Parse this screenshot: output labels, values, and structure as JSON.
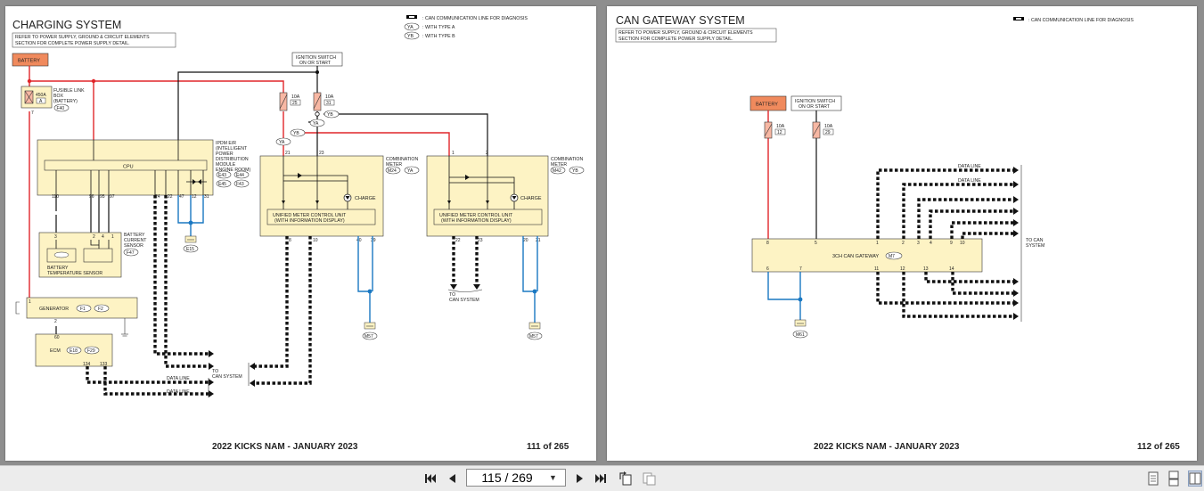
{
  "left_page": {
    "title": "CHARGING SYSTEM",
    "note_line1": "REFER TO POWER SUPPLY, GROUND & CIRCUIT ELEMENTS",
    "note_line2": "SECTION FOR COMPLETE POWER SUPPLY DETAIL.",
    "legend": {
      "can_line": ": CAN COMMUNICATION LINE FOR DIAGNOSIS",
      "type_a_tag": "YA",
      "type_a": ": WITH TYPE A",
      "type_b_tag": "YB",
      "type_b": ": WITH TYPE B"
    },
    "battery": "BATTERY",
    "ignition_line1": "IGNITION SWITCH",
    "ignition_line2": "ON OR START",
    "fuse_link": {
      "rating": "450A",
      "id": "A",
      "pin": "7",
      "label1": "FUSIBLE LINK",
      "label2": "BOX",
      "label3": "(BATTERY)",
      "connector": "F40"
    },
    "fuse_25": {
      "rating": "10A",
      "id": "25"
    },
    "fuse_31": {
      "rating": "10A",
      "id": "31"
    },
    "ipdm": {
      "label1": "IPDM E/R",
      "label2": "(INTELLIGENT",
      "label3": "POWER",
      "label4": "DISTRIBUTION",
      "label5": "MODULE",
      "label6": "ENGINE ROOM)",
      "conn1": "E43",
      "conn2": "E44",
      "conn3": "E45",
      "conn4": "F43",
      "cpu": "CPU",
      "pins": [
        "110",
        "96",
        "95",
        "97",
        "24",
        "22",
        "47",
        "12",
        "31"
      ]
    },
    "sensor": {
      "label1": "BATTERY",
      "label2": "CURRENT",
      "label3": "SENSOR",
      "connector": "F47",
      "temp1": "BATTERY",
      "temp2": "TEMPERATURE SENSOR",
      "pins": [
        "3",
        "2",
        "4",
        "1"
      ]
    },
    "ground_e15": "E15",
    "generator": {
      "label": "GENERATOR",
      "conn1": "F1",
      "conn2": "F2",
      "pin_top": "1",
      "pin_bottom": "2"
    },
    "ecm": {
      "label": "ECM",
      "conn1": "E18",
      "conn2": "F29",
      "pin_top": "60",
      "pin1": "134",
      "pin2": "133"
    },
    "meter_a": {
      "label1": "COMBINATION",
      "label2": "METER",
      "connector": "M24",
      "type_tag": "YA",
      "ucu1": "UNIFIED METER CONTROL UNIT",
      "ucu2": "(WITH INFORMATION DISPLAY)",
      "charge": "CHARGE",
      "pins_top": [
        "21",
        "23"
      ],
      "pins_bottom": [
        "8",
        "10",
        "40",
        "39"
      ],
      "ground": "M57"
    },
    "meter_b": {
      "label1": "COMBINATION",
      "label2": "METER",
      "connector": "M42",
      "type_tag": "YB",
      "ucu1": "UNIFIED METER CONTROL UNIT",
      "ucu2": "(WITH INFORMATION DISPLAY)",
      "charge": "CHARGE",
      "pins_top": [
        "1",
        "2"
      ],
      "pins_bottom": [
        "22",
        "23",
        "20",
        "21"
      ],
      "ground": "M57"
    },
    "to_can_b_1": "TO",
    "to_can_b_2": "CAN SYSTEM",
    "to_can_1": "TO",
    "to_can_2": "CAN SYSTEM",
    "data_line_1": "DATA LINE",
    "data_line_2": "DATA LINE",
    "footer_title": "2022 KICKS NAM - JANUARY 2023",
    "footer_page": "111 of 265"
  },
  "right_page": {
    "title": "CAN GATEWAY SYSTEM",
    "note_line1": "REFER TO POWER SUPPLY, GROUND & CIRCUIT ELEMENTS",
    "note_line2": "SECTION FOR COMPLETE POWER SUPPLY DETAIL.",
    "legend_can_line": ": CAN COMMUNICATION LINE FOR DIAGNOSIS",
    "battery": "BATTERY",
    "ignition_line1": "IGNITION SWITCH",
    "ignition_line2": "ON OR START",
    "fuse_12": {
      "rating": "10A",
      "id": "12"
    },
    "fuse_29": {
      "rating": "10A",
      "id": "29"
    },
    "gateway": {
      "label": "3CH CAN GATEWAY",
      "connector": "M7",
      "pins_top": [
        "8",
        "5",
        "1",
        "2",
        "3",
        "4",
        "9",
        "10"
      ],
      "pins_bottom": [
        "6",
        "7",
        "11",
        "12",
        "13",
        "14"
      ]
    },
    "data_line_1": "DATA LINE",
    "data_line_2": "DATA LINE",
    "to_can_1": "TO CAN",
    "to_can_2": "SYSTEM",
    "ground": "M61",
    "footer_title": "2022 KICKS NAM - JANUARY 2023",
    "footer_page": "112 of 265"
  },
  "toolbar": {
    "first_icon": "first-page-icon",
    "prev_icon": "previous-page-icon",
    "page_value": "115 / 269",
    "next_icon": "next-page-icon",
    "last_icon": "last-page-icon",
    "rotate_icon": "rotate-icon",
    "fit_icon": "fit-page-icon",
    "view_single_icon": "single-page-view-icon",
    "view_continuous_icon": "continuous-view-icon",
    "view_facing_icon": "facing-pages-view-icon"
  },
  "colors": {
    "battery_fill": "#f08a5d",
    "component_fill": "#fdf3c4",
    "power_wire": "#e0262a",
    "ground_wire": "#1a78c2",
    "signal_wire": "#000000"
  }
}
